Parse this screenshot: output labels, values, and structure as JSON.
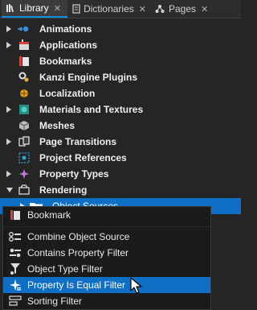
{
  "tabs": [
    {
      "label": "Library",
      "icon": "library-icon",
      "active": true
    },
    {
      "label": "Dictionaries",
      "icon": "dictionaries-icon",
      "active": false
    },
    {
      "label": "Pages",
      "icon": "pages-icon",
      "active": false
    }
  ],
  "close_glyph": "✕",
  "tree": [
    {
      "label": "Animations",
      "icon": "animations-icon",
      "expandable": true
    },
    {
      "label": "Applications",
      "icon": "applications-icon",
      "expandable": true
    },
    {
      "label": "Bookmarks",
      "icon": "bookmarks-icon",
      "expandable": false
    },
    {
      "label": "Kanzi Engine Plugins",
      "icon": "plugins-icon",
      "expandable": false
    },
    {
      "label": "Localization",
      "icon": "localization-icon",
      "expandable": false
    },
    {
      "label": "Materials and Textures",
      "icon": "materials-icon",
      "expandable": true
    },
    {
      "label": "Meshes",
      "icon": "meshes-icon",
      "expandable": false
    },
    {
      "label": "Page Transitions",
      "icon": "page-transitions-icon",
      "expandable": true
    },
    {
      "label": "Project References",
      "icon": "project-references-icon",
      "expandable": false
    },
    {
      "label": "Property Types",
      "icon": "property-types-icon",
      "expandable": true
    },
    {
      "label": "Rendering",
      "icon": "rendering-icon",
      "expandable": true,
      "expanded": true
    },
    {
      "label": "Object Sources",
      "icon": "folder-icon",
      "expandable": true,
      "selected": true
    }
  ],
  "context_menu": [
    {
      "label": "Bookmark",
      "icon": "bookmark-icon"
    },
    {
      "label": "Combine Object Source",
      "icon": "combine-object-source-icon"
    },
    {
      "label": "Contains Property Filter",
      "icon": "contains-property-filter-icon"
    },
    {
      "label": "Object Type Filter",
      "icon": "object-type-filter-icon"
    },
    {
      "label": "Property Is Equal Filter",
      "icon": "property-is-equal-filter-icon",
      "hover": true
    },
    {
      "label": "Sorting Filter",
      "icon": "sorting-filter-icon"
    }
  ],
  "colors": {
    "accent": "#0e6fc4",
    "background": "#252526",
    "menu_background": "#1b1b1c"
  }
}
